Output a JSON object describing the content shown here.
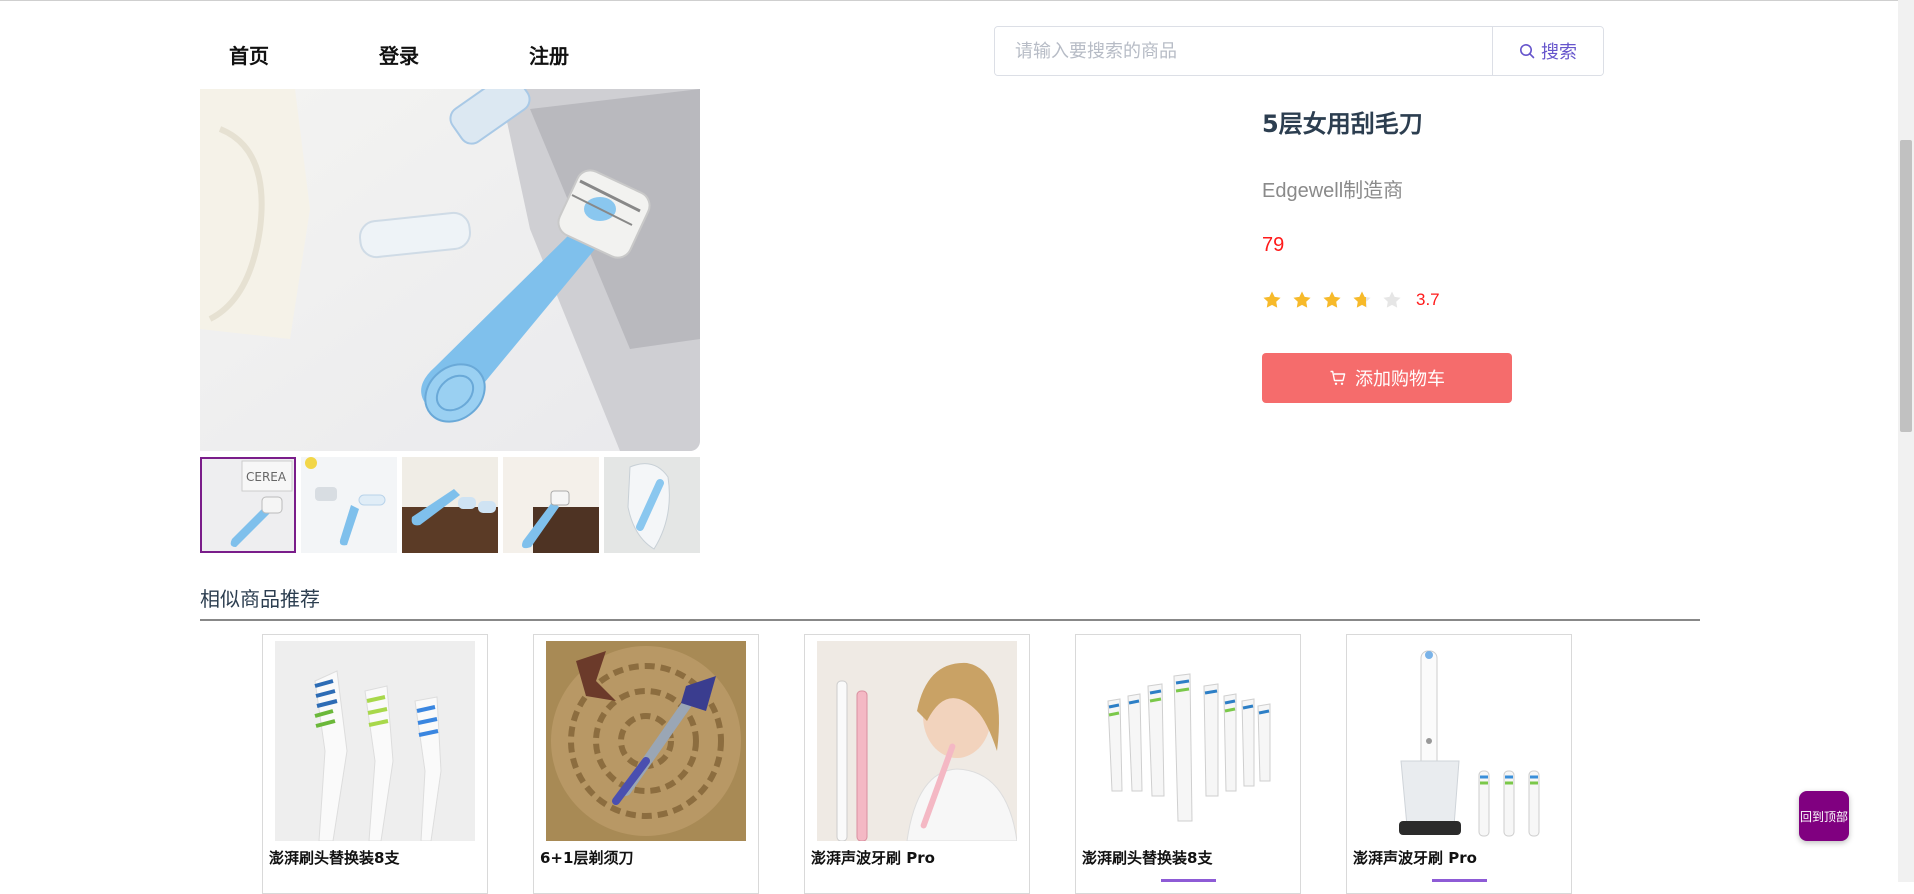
{
  "nav": {
    "home": "首页",
    "login": "登录",
    "register": "注册"
  },
  "search": {
    "placeholder": "请输入要搜索的商品",
    "button_label": "搜索"
  },
  "product": {
    "title": "5层女用刮毛刀",
    "brand": "Edgewell制造商",
    "price": "79",
    "rating": 3.7,
    "rating_text": "3.7",
    "add_to_cart_label": "添加购物车",
    "thumbnail_count": 5,
    "active_thumbnail": 0
  },
  "recommend": {
    "title": "相似商品推荐",
    "items": [
      {
        "name": "澎湃刷头替换装8支"
      },
      {
        "name": "6+1层剃须刀"
      },
      {
        "name": "澎湃声波牙刷 Pro"
      },
      {
        "name": "澎湃刷头替换装8支"
      },
      {
        "name": "澎湃声波牙刷 Pro"
      }
    ]
  },
  "back_to_top_label": "回到顶部",
  "colors": {
    "price": "#ff1a1a",
    "cart_button": "#f56c6c",
    "accent": "#800080",
    "star": "#f7ba2a"
  }
}
